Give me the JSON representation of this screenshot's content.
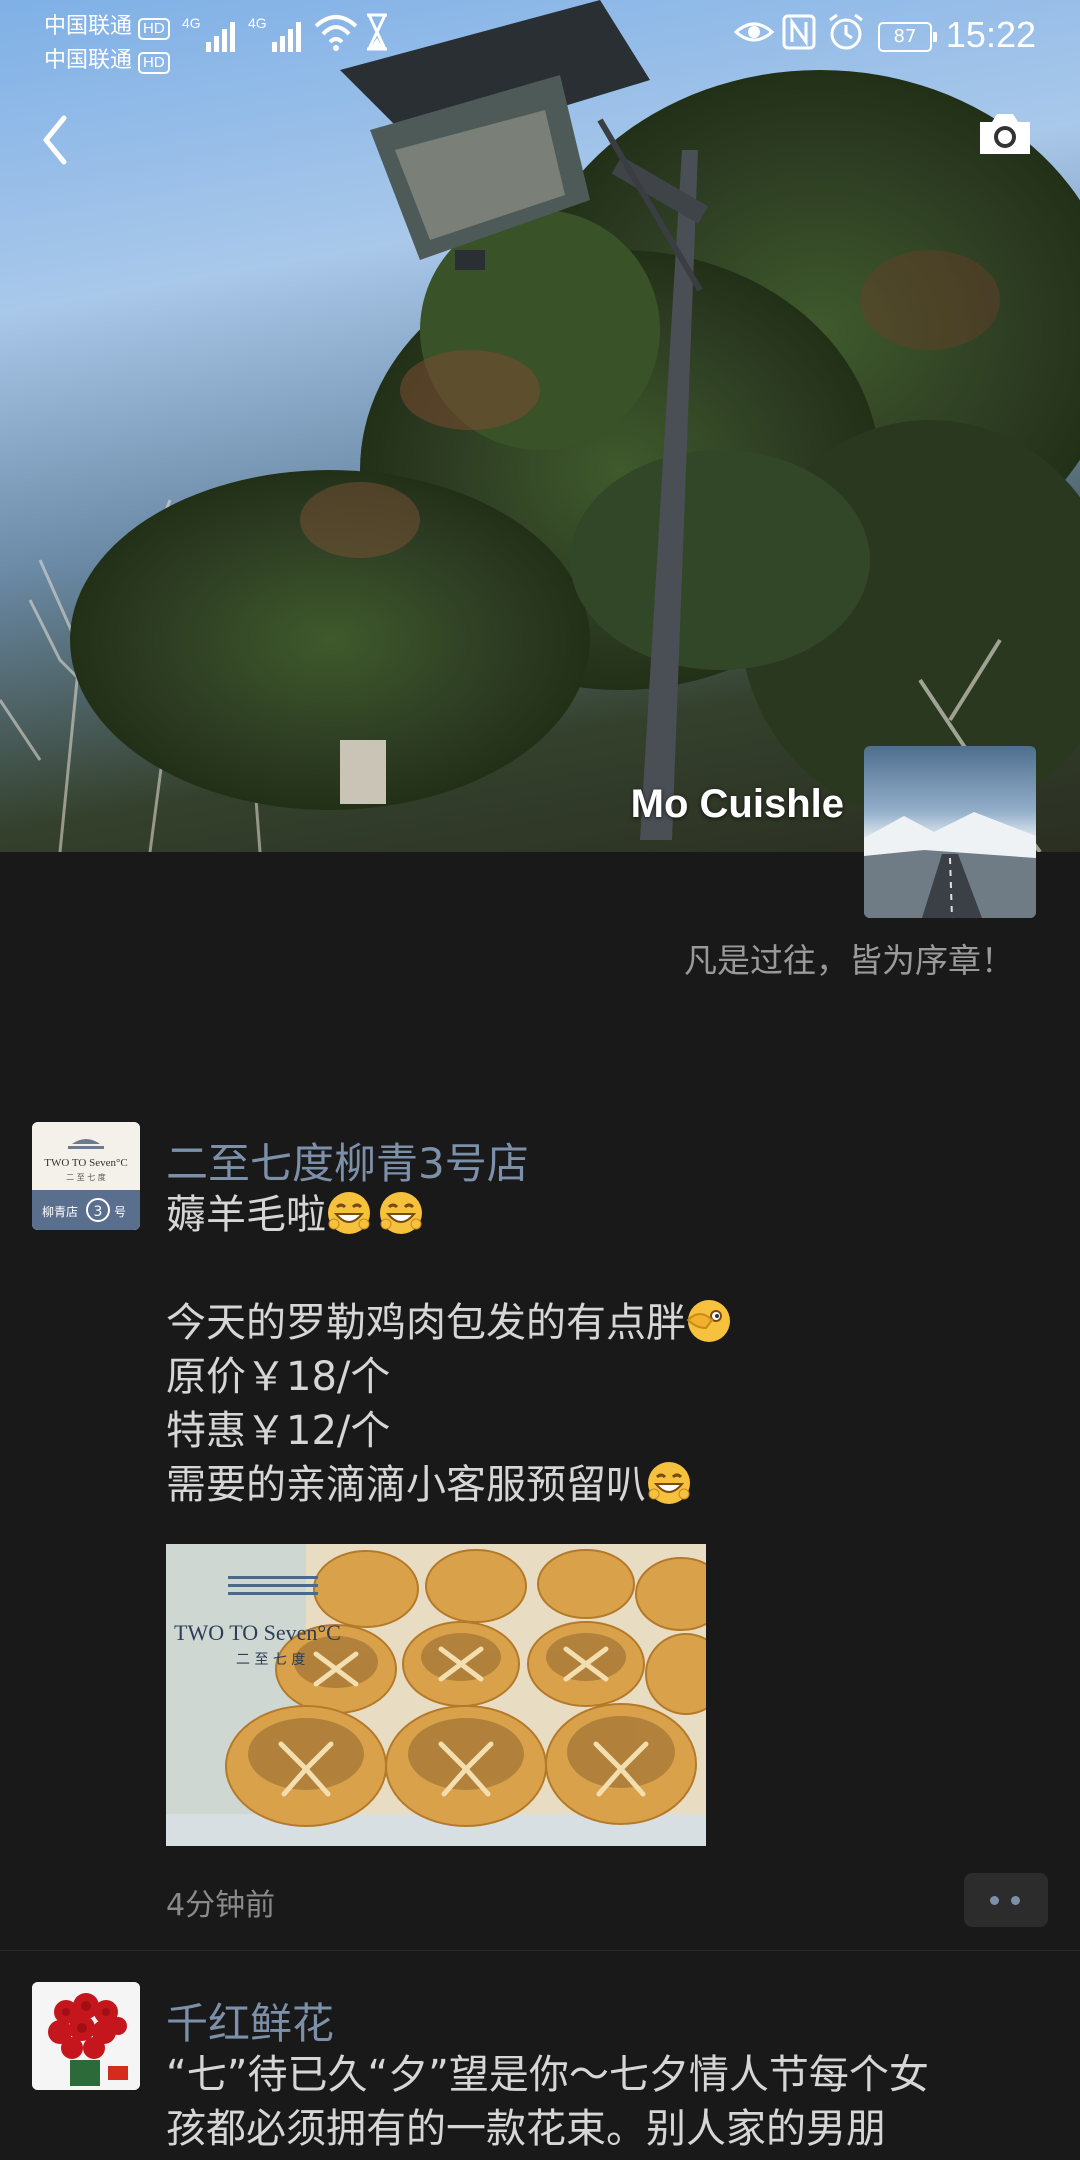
{
  "status_bar": {
    "carrier1": "中国联通",
    "carrier2": "中国联通",
    "hd": "HD",
    "network1": "4G",
    "network2": "4G",
    "battery": "87",
    "time": "15:22"
  },
  "profile": {
    "name": "Mo Cuishle",
    "signature": "凡是过往，皆为序章！"
  },
  "posts": [
    {
      "author": "二至七度柳青3号店",
      "avatar_text": {
        "line1": "TWO TO Seven°C",
        "line2": "二 至 七 度",
        "badge_pre": "柳青店",
        "badge_num": "3",
        "badge_post": "号"
      },
      "lines": [
        "薅羊毛啦",
        "",
        "今天的罗勒鸡肉包发的有点胖",
        "原价￥18/个",
        "特惠￥12/个",
        "需要的亲滴滴小客服预留叭"
      ],
      "photo_watermark": {
        "line1": "TWO TO Seven°C",
        "line2": "二 至 七 度"
      },
      "time": "4分钟前"
    },
    {
      "author": "千红鲜花",
      "lines": [
        "“七”待已久“夕”望是你～七夕情人节每个女",
        "孩都必须拥有的一款花束。别人家的男朋"
      ]
    }
  ],
  "icons": [
    "back-arrow-icon",
    "camera-icon",
    "signal-icon",
    "wifi-icon",
    "hourglass-icon",
    "eye-icon",
    "nfc-icon",
    "alarm-icon",
    "battery-icon",
    "more-dots-icon"
  ],
  "colors": {
    "background": "#191919",
    "author_link": "#7d90aa",
    "body_text": "#d6d6d6",
    "meta_text": "#8a8a8a"
  }
}
